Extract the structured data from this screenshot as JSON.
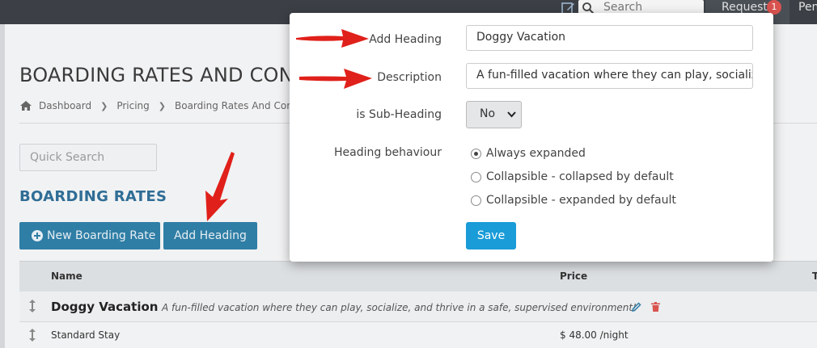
{
  "topbar": {
    "search_placeholder": "Search",
    "requests_label": "Requests",
    "requests_count": "1",
    "pending_label": "Pen"
  },
  "page": {
    "title": "BOARDING RATES AND CONFI",
    "breadcrumb": [
      "Dashboard",
      "Pricing",
      "Boarding Rates And Configur"
    ],
    "quick_search_placeholder": "Quick Search",
    "section_title": "BOARDING RATES",
    "new_rate_button": "New Boarding Rate",
    "add_heading_button": "Add Heading"
  },
  "table": {
    "columns": {
      "name": "Name",
      "price": "Price",
      "extra": "T"
    },
    "heading_row": {
      "name": "Doggy Vacation",
      "description": "A fun-filled vacation where they can play, socialize, and thrive in a safe, supervised environment!"
    },
    "rows": [
      {
        "name": "Standard Stay",
        "price": "$ 48.00 /night"
      }
    ]
  },
  "modal": {
    "heading_label": "Add Heading",
    "heading_value": "Doggy Vacation",
    "description_label": "Description",
    "description_value": "A fun-filled vacation where they can play, socialize",
    "subheading_label": "is Sub-Heading",
    "subheading_value": "No",
    "behaviour_label": "Heading behaviour",
    "behaviour_options": [
      {
        "label": "Always expanded",
        "selected": true
      },
      {
        "label": "Collapsible - collapsed by default",
        "selected": false
      },
      {
        "label": "Collapsible - expanded by default",
        "selected": false
      }
    ],
    "save_label": "Save"
  },
  "colors": {
    "topbar": "#3c4046",
    "primary_button": "#2f7ea6",
    "save_button": "#1a9cd8",
    "section_title": "#2f6d96",
    "annotation_arrow": "#e0201a",
    "badge": "#d9534f"
  }
}
